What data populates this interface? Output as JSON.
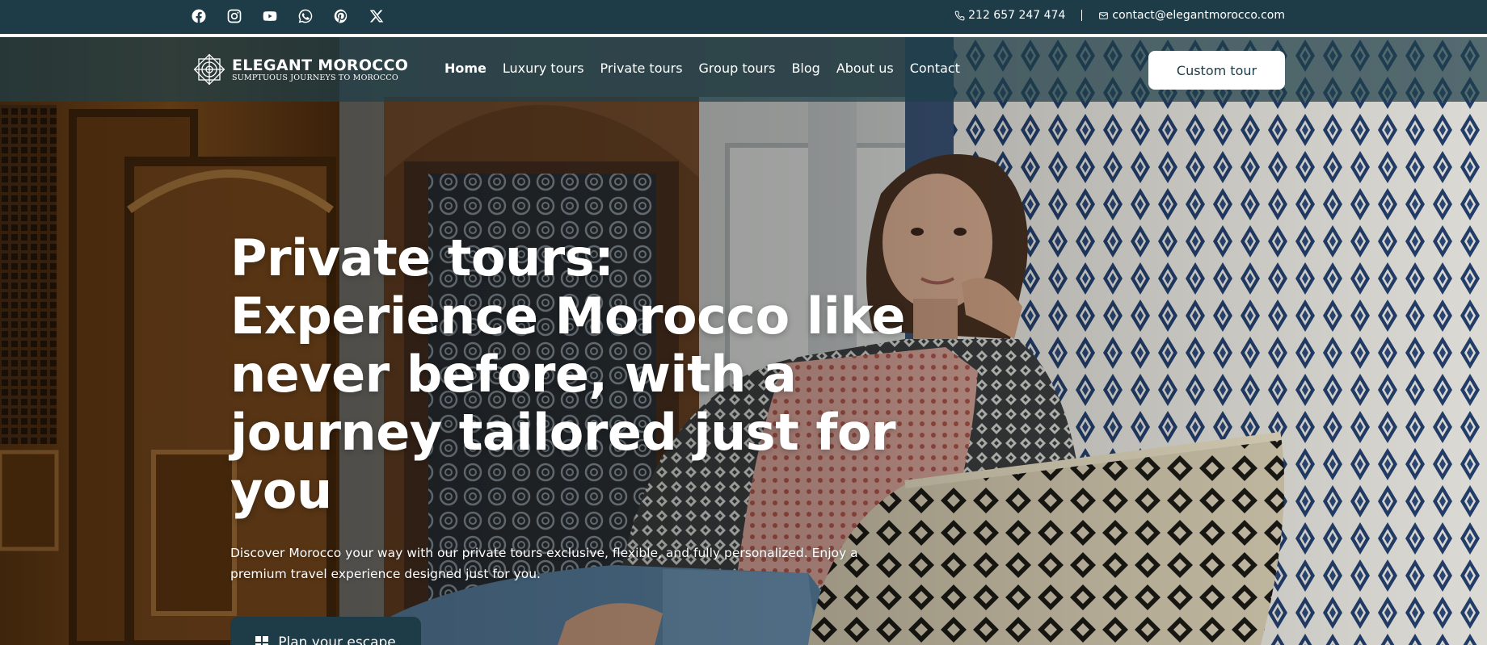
{
  "topbar": {
    "socials": [
      {
        "name": "facebook-icon"
      },
      {
        "name": "instagram-icon"
      },
      {
        "name": "youtube-icon"
      },
      {
        "name": "whatsapp-icon"
      },
      {
        "name": "pinterest-icon"
      },
      {
        "name": "x-twitter-icon"
      }
    ],
    "phone": "212 657 247 474",
    "email": "contact@elegantmorocco.com"
  },
  "logo": {
    "title": "ELEGANT MOROCCO",
    "subtitle": "SUMPTUOUS JOURNEYS TO MOROCCO"
  },
  "nav": {
    "links": [
      "Home",
      "Luxury tours",
      "Private tours",
      "Group tours",
      "Blog",
      "About us",
      "Contact"
    ],
    "active": "Home",
    "cta_label": "Custom tour"
  },
  "hero": {
    "title": "Private tours: Experience Morocco like never before, with a journey tailored just for you",
    "description": "Discover Morocco your way with our private tours exclusive, flexible, and fully personalized. Enjoy a premium travel experience designed just for you.",
    "cta_label": "Plan your escape"
  },
  "colors": {
    "brand_dark": "#1e3c47",
    "white": "#ffffff"
  }
}
